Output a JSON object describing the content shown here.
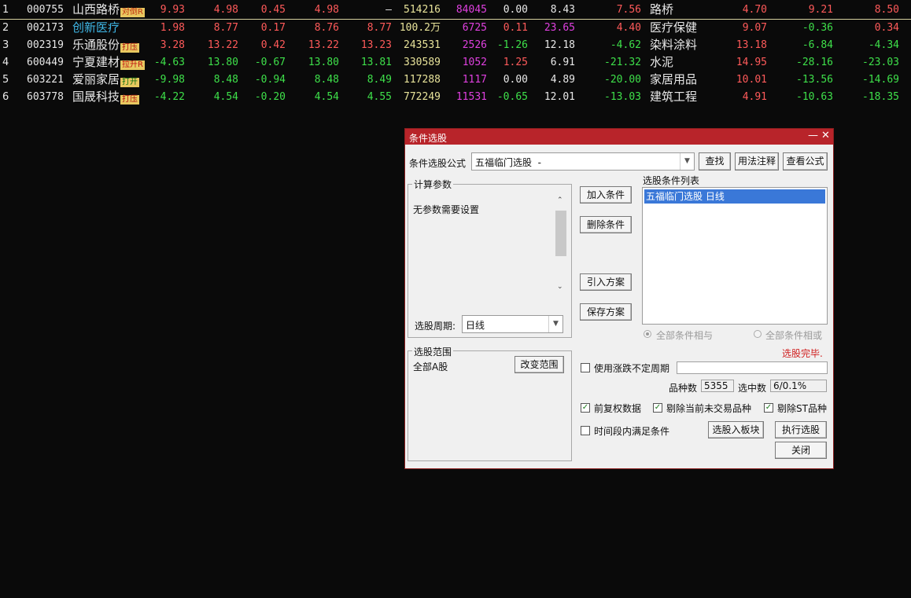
{
  "rows": [
    {
      "idx": "1",
      "code": "000755",
      "name": "山西路桥",
      "name_color": "white",
      "tag": "对倒R",
      "tag_style": "tag-orange",
      "c1": "9.93",
      "c2": "4.98",
      "c3": "0.45",
      "c4": "4.98",
      "c5": "—",
      "c6": "514216",
      "c7": "84045",
      "c8": "0.00",
      "c9": "8.43",
      "c10": "7.56",
      "industry": "路桥",
      "c11": "4.70",
      "c12": "9.21",
      "c13": "8.50",
      "colors": [
        "red",
        "red",
        "red",
        "red",
        "white",
        "yellow",
        "magenta",
        "white",
        "white",
        "red",
        "red",
        "red",
        "red"
      ]
    },
    {
      "idx": "2",
      "code": "002173",
      "name": "创新医疗",
      "name_color": "cyan",
      "tag": "",
      "tag_style": "",
      "c1": "1.98",
      "c2": "8.77",
      "c3": "0.17",
      "c4": "8.76",
      "c5": "8.77",
      "c6": "100.2万",
      "c7": "6725",
      "c8": "0.11",
      "c9": "23.65",
      "c10": "4.40",
      "industry": "医疗保健",
      "c11": "9.07",
      "c12": "-0.36",
      "c13": "0.34",
      "colors": [
        "red",
        "red",
        "red",
        "red",
        "red",
        "yellow",
        "magenta",
        "red",
        "magenta",
        "red",
        "red",
        "green",
        "red"
      ]
    },
    {
      "idx": "3",
      "code": "002319",
      "name": "乐通股份",
      "name_color": "white",
      "tag": "打压",
      "tag_style": "tag-yellow",
      "c1": "3.28",
      "c2": "13.22",
      "c3": "0.42",
      "c4": "13.22",
      "c5": "13.23",
      "c6": "243531",
      "c7": "2526",
      "c8": "-1.26",
      "c9": "12.18",
      "c10": "-4.62",
      "industry": "染料涂料",
      "c11": "13.18",
      "c12": "-6.84",
      "c13": "-4.34",
      "colors": [
        "red",
        "red",
        "red",
        "red",
        "red",
        "yellow",
        "magenta",
        "green",
        "white",
        "green",
        "red",
        "green",
        "green"
      ]
    },
    {
      "idx": "4",
      "code": "600449",
      "name": "宁夏建材",
      "name_color": "white",
      "tag": "拉升R",
      "tag_style": "tag-red",
      "c1": "-4.63",
      "c2": "13.80",
      "c3": "-0.67",
      "c4": "13.80",
      "c5": "13.81",
      "c6": "330589",
      "c7": "1052",
      "c8": "1.25",
      "c9": "6.91",
      "c10": "-21.32",
      "industry": "水泥",
      "c11": "14.95",
      "c12": "-28.16",
      "c13": "-23.03",
      "colors": [
        "green",
        "green",
        "green",
        "green",
        "green",
        "yellow",
        "magenta",
        "red",
        "white",
        "green",
        "red",
        "green",
        "green"
      ]
    },
    {
      "idx": "5",
      "code": "603221",
      "name": "爱丽家居",
      "name_color": "white",
      "tag": "打开",
      "tag_style": "tag-green",
      "c1": "-9.98",
      "c2": "8.48",
      "c3": "-0.94",
      "c4": "8.48",
      "c5": "8.49",
      "c6": "117288",
      "c7": "1117",
      "c8": "0.00",
      "c9": "4.89",
      "c10": "-20.00",
      "industry": "家居用品",
      "c11": "10.01",
      "c12": "-13.56",
      "c13": "-14.69",
      "colors": [
        "green",
        "green",
        "green",
        "green",
        "green",
        "yellow",
        "magenta",
        "white",
        "white",
        "green",
        "red",
        "green",
        "green"
      ]
    },
    {
      "idx": "6",
      "code": "603778",
      "name": "国晟科技",
      "name_color": "white",
      "tag": "打压",
      "tag_style": "tag-yellow",
      "c1": "-4.22",
      "c2": "4.54",
      "c3": "-0.20",
      "c4": "4.54",
      "c5": "4.55",
      "c6": "772249",
      "c7": "11531",
      "c8": "-0.65",
      "c9": "12.01",
      "c10": "-13.03",
      "industry": "建筑工程",
      "c11": "4.91",
      "c12": "-10.63",
      "c13": "-18.35",
      "colors": [
        "green",
        "green",
        "green",
        "green",
        "green",
        "yellow",
        "magenta",
        "green",
        "white",
        "green",
        "red",
        "green",
        "green"
      ]
    }
  ],
  "dialog": {
    "title": "条件选股",
    "min_icon": "—",
    "close_icon": "✕",
    "formula_label": "条件选股公式",
    "formula_value": "五福临门选股  -",
    "find_btn": "查找",
    "usage_btn": "用法注释",
    "view_btn": "查看公式",
    "params_title": "计算参数",
    "params_text": "无参数需要设置",
    "period_label": "选股周期:",
    "period_value": "日线",
    "add_btn": "加入条件",
    "del_btn": "删除条件",
    "import_btn": "引入方案",
    "save_btn": "保存方案",
    "list_title": "选股条件列表",
    "list_item": "五福临门选股  日线",
    "radio_and": "全部条件相与",
    "radio_or": "全部条件相或",
    "status": "选股完毕.",
    "range_title": "选股范围",
    "range_value": "全部A股",
    "change_range_btn": "改变范围",
    "use_period_label": "使用涨跌不定周期",
    "count_label": "品种数",
    "count_value": "5355",
    "selected_label": "选中数",
    "selected_value": "6/0.1%",
    "fq_label": "前复权数据",
    "exclude_today_label": "剔除当前未交易品种",
    "exclude_st_label": "剔除ST品种",
    "time_cond_label": "时间段内满足条件",
    "to_block_btn": "选股入板块",
    "run_btn": "执行选股",
    "close_btn": "关闭",
    "status_color": "#d02020"
  }
}
